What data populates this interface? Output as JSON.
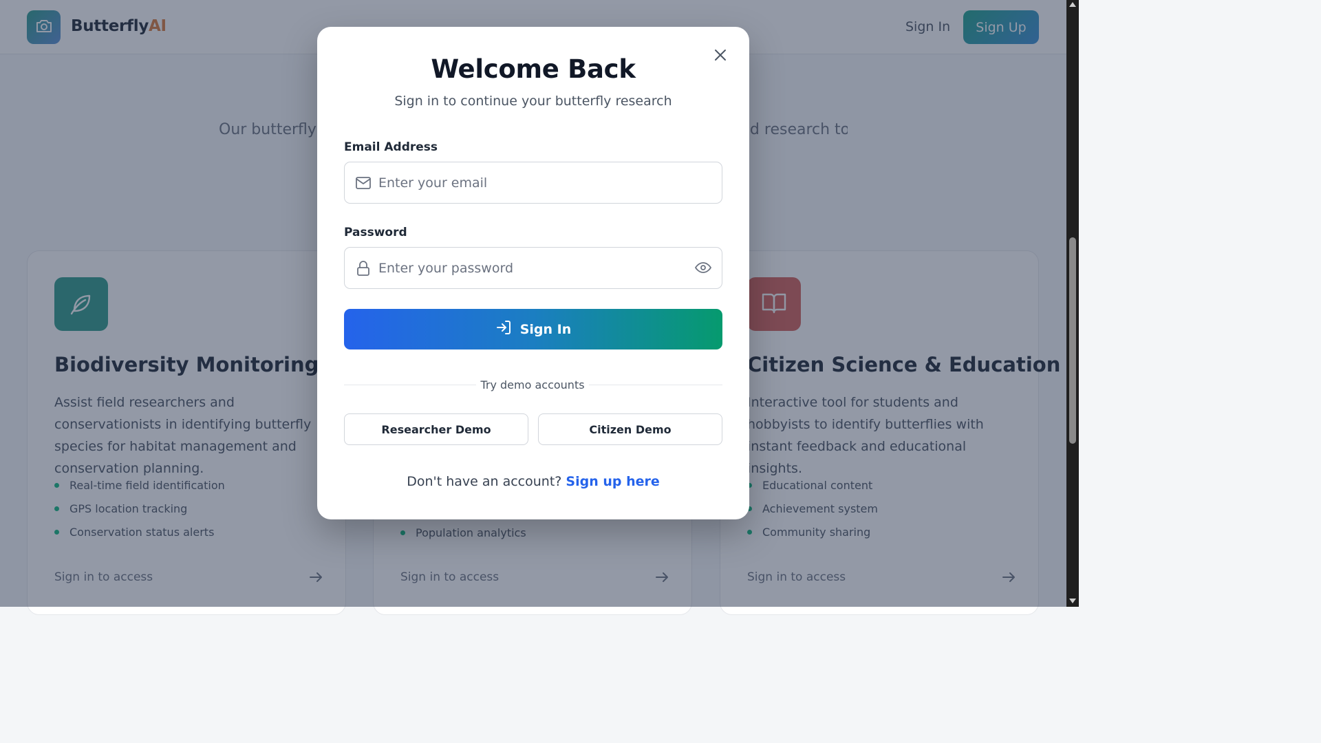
{
  "header": {
    "brand_main": "Butterfly",
    "brand_accent": "AI",
    "sign_in_label": "Sign In",
    "sign_up_label": "Sign Up"
  },
  "hero": {
    "description_visible_start": "Our butterfly",
    "description_visible_end": "d research to"
  },
  "cards": [
    {
      "icon": "leaf-icon",
      "title": "Biodiversity Monitoring",
      "description": "Assist field researchers and conservationists in identifying butterfly species for habitat management and conservation planning.",
      "features": [
        "Real-time field identification",
        "GPS location tracking",
        "Conservation status alerts"
      ],
      "link_label": "Sign in to access"
    },
    {
      "features_visible": [
        "Population analytics"
      ],
      "link_label": "Sign in to access"
    },
    {
      "icon": "book-icon",
      "title": "Citizen Science & Education",
      "description": "Interactive tool for students and hobbyists to identify butterflies with instant feedback and educational insights.",
      "features": [
        "Educational content",
        "Achievement system",
        "Community sharing"
      ],
      "link_label": "Sign in to access"
    }
  ],
  "modal": {
    "title": "Welcome Back",
    "subtitle": "Sign in to continue your butterfly research",
    "email_label": "Email Address",
    "email_placeholder": "Enter your email",
    "email_value": "",
    "password_label": "Password",
    "password_placeholder": "Enter your password",
    "password_value": "",
    "submit_label": "Sign In",
    "divider_text": "Try demo accounts",
    "demo_researcher_label": "Researcher Demo",
    "demo_citizen_label": "Citizen Demo",
    "no_account_text": "Don't have an account?",
    "signup_link_label": "Sign up here"
  },
  "colors": {
    "accent_blue": "#2563eb",
    "accent_green": "#069a6e",
    "brand_orange": "#d97a3c",
    "teal": "#1fa38c"
  }
}
